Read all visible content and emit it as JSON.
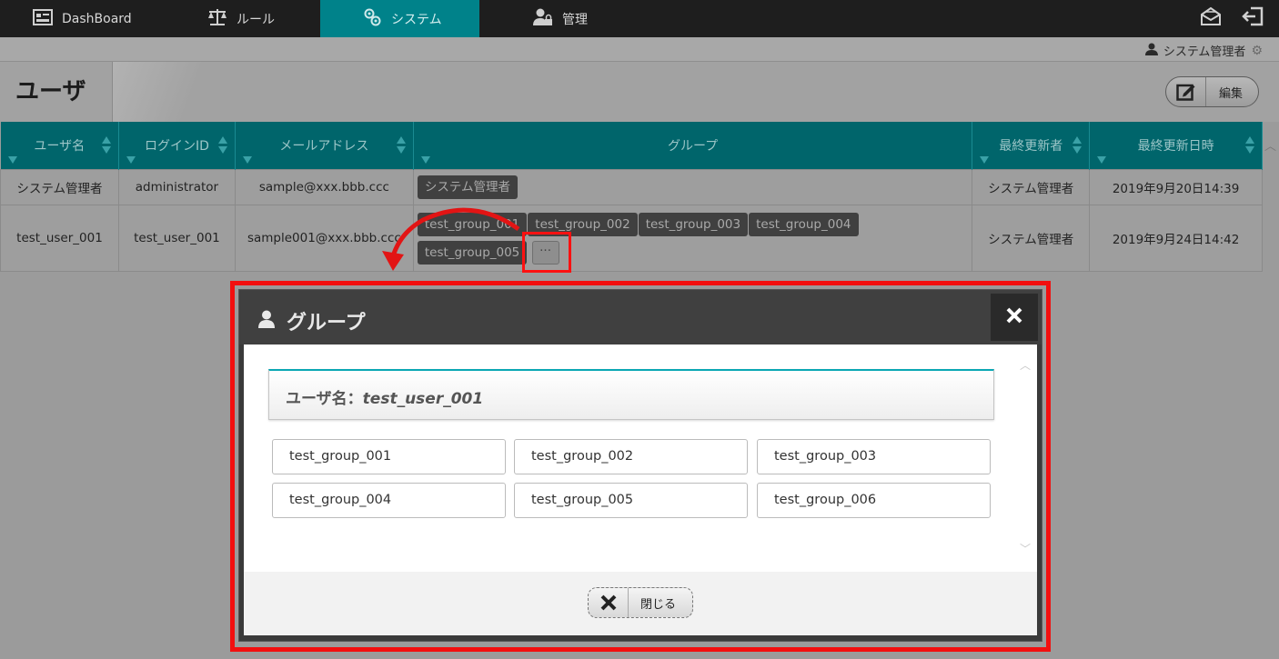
{
  "nav": {
    "items": [
      {
        "label": "DashBoard",
        "icon": "dashboard-icon"
      },
      {
        "label": "ルール",
        "icon": "scale-icon"
      },
      {
        "label": "システム",
        "icon": "gears-icon",
        "active": true
      },
      {
        "label": "管理",
        "icon": "user-lock-icon"
      }
    ]
  },
  "header": {
    "user_name": "システム管理者",
    "page_title": "ユーザ",
    "edit_label": "編集"
  },
  "table": {
    "columns": [
      "ユーザ名",
      "ログインID",
      "メールアドレス",
      "グループ",
      "最終更新者",
      "最終更新日時"
    ],
    "rows": [
      {
        "user_name": "システム管理者",
        "login_id": "administrator",
        "email": "sample@xxx.bbb.ccc",
        "groups": [
          "システム管理者"
        ],
        "updated_by": "システム管理者",
        "updated_at": "2019年9月20日14:39"
      },
      {
        "user_name": "test_user_001",
        "login_id": "test_user_001",
        "email": "sample001@xxx.bbb.ccc",
        "groups": [
          "test_group_001",
          "test_group_002",
          "test_group_003",
          "test_group_004",
          "test_group_005"
        ],
        "more_label": "···",
        "updated_by": "システム管理者",
        "updated_at": "2019年9月24日14:42"
      }
    ]
  },
  "modal": {
    "title": "グループ",
    "user_label": "ユーザ名：",
    "user_value": "test_user_001",
    "groups": [
      "test_group_001",
      "test_group_002",
      "test_group_003",
      "test_group_004",
      "test_group_005",
      "test_group_006"
    ],
    "close_label": "閉じる"
  },
  "colors": {
    "accent": "#00828a",
    "header_teal": "#00656b",
    "highlight_red": "#f20f0f",
    "nav_bg": "#1e1e1e"
  }
}
